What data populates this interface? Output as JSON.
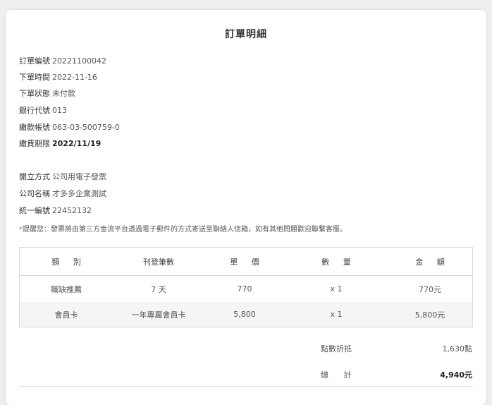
{
  "title": "訂單明細",
  "info": [
    {
      "label": "訂單編號",
      "value": "20221100042"
    },
    {
      "label": "下單時間",
      "value": "2022-11-16"
    },
    {
      "label": "下單狀態",
      "value": "未付款"
    },
    {
      "label": "銀行代號",
      "value": "013"
    },
    {
      "label": "繳款帳號",
      "value": "063-03-500759-0"
    },
    {
      "label": "繳費期限",
      "value": "2022/11/19"
    }
  ],
  "invoice": [
    {
      "label": "開立方式",
      "value": "公司用電子發票"
    },
    {
      "label": "公司名稱",
      "value": "才多多企業測試"
    },
    {
      "label": "統一編號",
      "value": "22452132"
    }
  ],
  "reminder": {
    "star": "*",
    "text": "提醒您：發票將由第三方金流平台透過電子郵件的方式寄送至聯絡人信箱，如有其他問題歡迎聯繫客服。"
  },
  "table": {
    "headers": [
      "類 別",
      "刊登筆數",
      "單 價",
      "數 量",
      "金 額"
    ],
    "rows": [
      [
        "職缺推薦",
        "7 天",
        "770",
        "x 1",
        "770元"
      ],
      [
        "會員卡",
        "一年專屬會員卡",
        "5,800",
        "x 1",
        "5,800元"
      ]
    ]
  },
  "summary": {
    "points_label": "點數折抵",
    "points_value": "1,630點",
    "total_label": "總 計",
    "total_value": "4,940元"
  }
}
